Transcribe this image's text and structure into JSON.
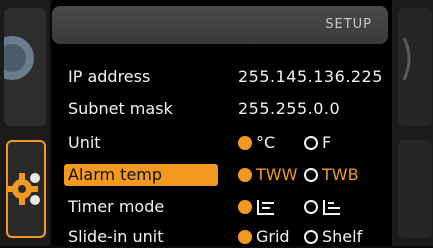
{
  "header": {
    "title": "SETUP"
  },
  "rows": {
    "ip": {
      "label": "IP address",
      "value": "255.145.136.225"
    },
    "subnet": {
      "label": "Subnet mask",
      "value": "255.255.0.0"
    },
    "unit": {
      "label": "Unit",
      "opt1": "°C",
      "opt2": "F"
    },
    "alarm": {
      "label": "Alarm temp",
      "opt1": "TWW",
      "opt2": "TWB"
    },
    "timer": {
      "label": "Timer mode"
    },
    "slidein": {
      "label": "Slide-in unit",
      "opt1": "Grid",
      "opt2": "Shelf"
    }
  },
  "colors": {
    "accent": "#f29a1f",
    "text": "#f2f2f2",
    "header": "#444444"
  },
  "icons": {
    "left_nav": [
      "dial-icon",
      "settings-gear-icon"
    ],
    "timer_modes": [
      "timer-mode-a-icon",
      "timer-mode-b-icon"
    ]
  }
}
